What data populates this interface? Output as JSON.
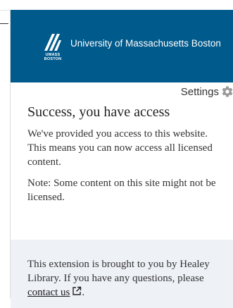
{
  "header": {
    "logo_text": "UMASS BOSTON",
    "logo_line1": "UMASS",
    "logo_line2": "BOSTON",
    "university_name": "University of Massachusetts Boston",
    "color": "#005a8c"
  },
  "settings": {
    "label": "Settings",
    "icon": "gear-icon"
  },
  "main": {
    "title": "Success, you have access",
    "paragraph1": "We've provided you access to this website. This means you can now access all licensed content.",
    "paragraph2": "Note: Some content on this site might not be licensed."
  },
  "footer": {
    "text_before": "This extension is brought to you by Healey Library. If you have any questions, please ",
    "link_label": "contact us",
    "link_icon": "external-link-icon",
    "text_after": ".",
    "background": "#eef1f6"
  }
}
